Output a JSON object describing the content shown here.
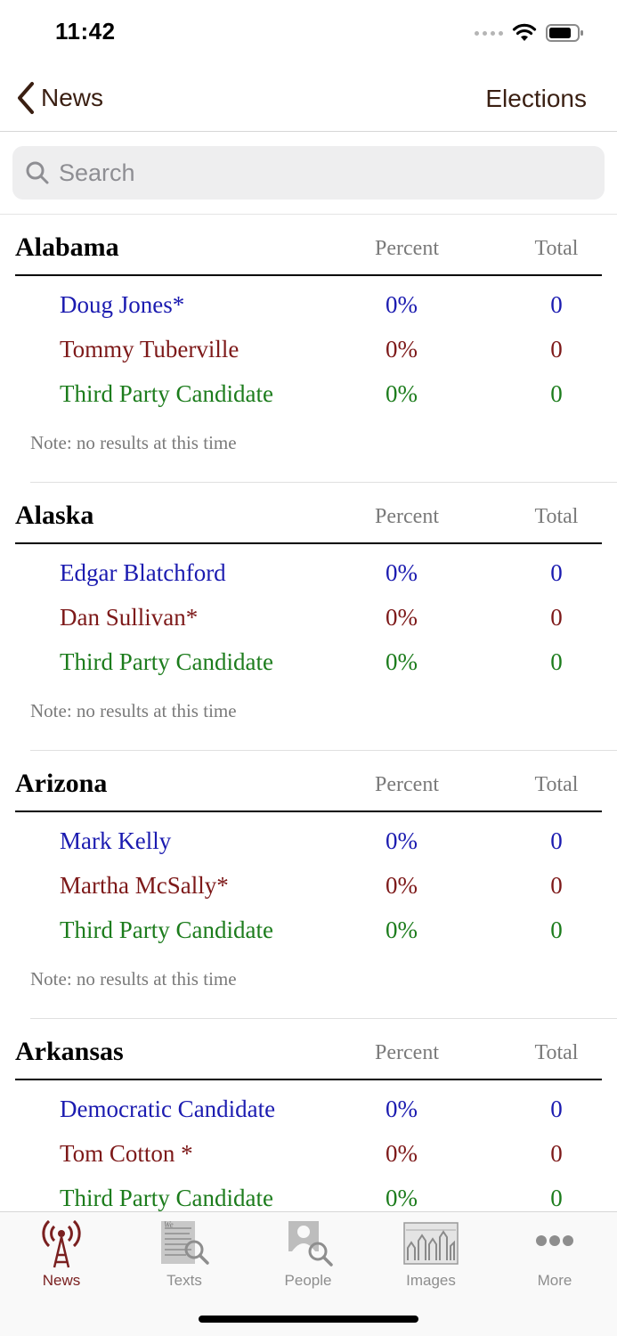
{
  "status_bar": {
    "time": "11:42"
  },
  "nav": {
    "back_label": "News",
    "title": "Elections"
  },
  "search": {
    "placeholder": "Search"
  },
  "columns": {
    "percent": "Percent",
    "total": "Total"
  },
  "states": [
    {
      "name": "Alabama",
      "candidates": [
        {
          "name": "Doug Jones*",
          "percent": "0%",
          "total": "0",
          "party": "dem"
        },
        {
          "name": "Tommy Tuberville",
          "percent": "0%",
          "total": "0",
          "party": "rep"
        },
        {
          "name": "Third Party Candidate",
          "percent": "0%",
          "total": "0",
          "party": "ind"
        }
      ],
      "note": "Note: no results at this time"
    },
    {
      "name": "Alaska",
      "candidates": [
        {
          "name": "Edgar Blatchford",
          "percent": "0%",
          "total": "0",
          "party": "dem"
        },
        {
          "name": "Dan Sullivan*",
          "percent": "0%",
          "total": "0",
          "party": "rep"
        },
        {
          "name": "Third Party Candidate",
          "percent": "0%",
          "total": "0",
          "party": "ind"
        }
      ],
      "note": "Note: no results at this time"
    },
    {
      "name": "Arizona",
      "candidates": [
        {
          "name": "Mark Kelly",
          "percent": "0%",
          "total": "0",
          "party": "dem"
        },
        {
          "name": "Martha McSally*",
          "percent": "0%",
          "total": "0",
          "party": "rep"
        },
        {
          "name": "Third Party Candidate",
          "percent": "0%",
          "total": "0",
          "party": "ind"
        }
      ],
      "note": "Note: no results at this time"
    },
    {
      "name": "Arkansas",
      "candidates": [
        {
          "name": "Democratic Candidate",
          "percent": "0%",
          "total": "0",
          "party": "dem"
        },
        {
          "name": "Tom Cotton *",
          "percent": "0%",
          "total": "0",
          "party": "rep"
        },
        {
          "name": "Third Party Candidate",
          "percent": "0%",
          "total": "0",
          "party": "ind"
        }
      ],
      "note": ""
    }
  ],
  "colors": {
    "dem": "#1b1bb0",
    "rep": "#7d1919",
    "ind": "#1c7c1c",
    "accent": "#7a2020",
    "nav_text": "#3a1f12"
  },
  "tabs": [
    {
      "label": "News",
      "icon": "antenna-icon",
      "active": true
    },
    {
      "label": "Texts",
      "icon": "constitution-search-icon",
      "active": false
    },
    {
      "label": "People",
      "icon": "person-search-icon",
      "active": false
    },
    {
      "label": "Images",
      "icon": "historic-image-icon",
      "active": false
    },
    {
      "label": "More",
      "icon": "more-dots-icon",
      "active": false
    }
  ]
}
